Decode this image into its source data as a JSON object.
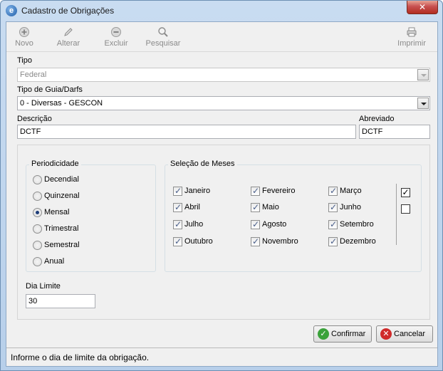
{
  "window": {
    "title": "Cadastro de Obrigações",
    "close_glyph": "✕"
  },
  "toolbar": {
    "novo": "Novo",
    "alterar": "Alterar",
    "excluir": "Excluir",
    "pesquisar": "Pesquisar",
    "imprimir": "Imprimir"
  },
  "form": {
    "tipo_label": "Tipo",
    "tipo_value": "Federal",
    "guia_label": "Tipo de Guia/Darfs",
    "guia_value": "0 - Diversas - GESCON",
    "descricao_label": "Descrição",
    "descricao_value": "DCTF",
    "abreviado_label": "Abreviado",
    "abreviado_value": "DCTF"
  },
  "periodicidade": {
    "title": "Periodicidade",
    "options": [
      "Decendial",
      "Quinzenal",
      "Mensal",
      "Trimestral",
      "Semestral",
      "Anual"
    ],
    "selected": "Mensal"
  },
  "meses": {
    "title": "Seleção de Meses",
    "items": [
      "Janeiro",
      "Fevereiro",
      "Março",
      "Abril",
      "Maio",
      "Junho",
      "Julho",
      "Agosto",
      "Setembro",
      "Outubro",
      "Novembro",
      "Dezembro"
    ],
    "all_checked": true
  },
  "dia_limite": {
    "label": "Dia Limite",
    "value": "30"
  },
  "buttons": {
    "confirmar": "Confirmar",
    "cancelar": "Cancelar"
  },
  "status": {
    "text": "Informe o dia de limite da obrigação."
  },
  "colors": {
    "confirm_icon": "#3aa23a",
    "cancel_icon": "#d02a2a",
    "title_bar": "#b7cfea"
  }
}
